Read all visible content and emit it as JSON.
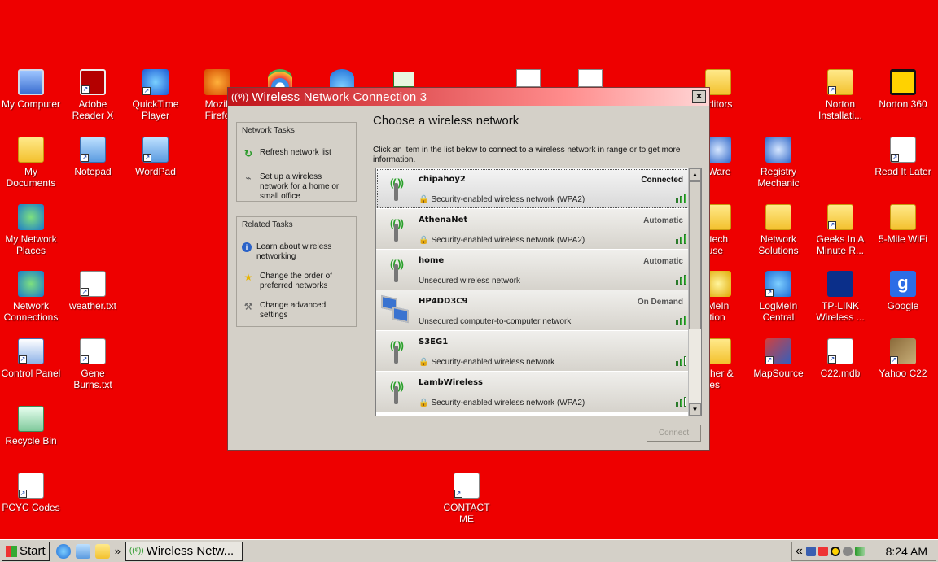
{
  "desktop": {
    "icons": [
      {
        "label": "My Computer"
      },
      {
        "label": "Adobe\nReader X"
      },
      {
        "label": "QuickTime\nPlayer"
      },
      {
        "label": "Mozill\nFirefo"
      },
      {
        "label": "My\nDocuments"
      },
      {
        "label": "Notepad"
      },
      {
        "label": "WordPad"
      },
      {
        "label": "My Network\nPlaces"
      },
      {
        "label": "Network\nConnections"
      },
      {
        "label": "weather.txt"
      },
      {
        "label": "Control Panel"
      },
      {
        "label": "Gene\nBurns.txt"
      },
      {
        "label": "Recycle Bin"
      },
      {
        "label": "PCYC Codes"
      },
      {
        "label": "CONTACT\nME"
      },
      {
        "label": "Editors"
      },
      {
        "label": "rtWare"
      },
      {
        "label": "gitech\nouse"
      },
      {
        "label": "gMeIn\nnition"
      },
      {
        "label": "ather &\nides"
      },
      {
        "label": "Registry\nMechanic"
      },
      {
        "label": "Network\nSolutions"
      },
      {
        "label": "LogMeIn\nCentral"
      },
      {
        "label": "MapSource"
      },
      {
        "label": "Norton\nInstallati..."
      },
      {
        "label": "Geeks In A\nMinute R..."
      },
      {
        "label": "TP-LINK\nWireless ..."
      },
      {
        "label": "C22.mdb"
      },
      {
        "label": "Norton 360"
      },
      {
        "label": "Read It Later"
      },
      {
        "label": "5-Mile WiFi"
      },
      {
        "label": "Google"
      },
      {
        "label": "Yahoo C22"
      }
    ]
  },
  "dialog": {
    "title": "Wireless Network Connection 3",
    "close": "×",
    "network_tasks": {
      "header": "Network Tasks",
      "items": [
        {
          "label": "Refresh network list"
        },
        {
          "label": "Set up a wireless network for a home or small office"
        }
      ]
    },
    "related_tasks": {
      "header": "Related Tasks",
      "items": [
        {
          "label": "Learn about wireless networking"
        },
        {
          "label": "Change the order of preferred networks"
        },
        {
          "label": "Change advanced settings"
        }
      ]
    },
    "heading": "Choose a wireless network",
    "intro": "Click an item in the list below to connect to a wireless network in range or to get more information.",
    "networks": [
      {
        "name": "chipahoy2",
        "status": "Connected",
        "desc": "Security-enabled wireless network (WPA2)",
        "secured": true,
        "signal": 5
      },
      {
        "name": "AthenaNet",
        "status": "Automatic",
        "desc": "Security-enabled wireless network (WPA2)",
        "secured": true,
        "signal": 4
      },
      {
        "name": "home",
        "status": "Automatic",
        "desc": "Unsecured wireless network",
        "secured": false,
        "signal": 4
      },
      {
        "name": "HP4DD3C9",
        "status": "On Demand",
        "desc": "Unsecured computer-to-computer network",
        "secured": false,
        "signal": 4
      },
      {
        "name": "S3EG1",
        "status": "",
        "desc": "Security-enabled wireless network",
        "secured": true,
        "signal": 2
      },
      {
        "name": "LambWireless",
        "status": "",
        "desc": "Security-enabled wireless network (WPA2)",
        "secured": true,
        "signal": 2
      }
    ],
    "connect_label": "Connect"
  },
  "taskbar": {
    "start_label": "Start",
    "chevron": "»",
    "task_button_label": "Wireless Netw...",
    "tray_chevron": "«",
    "clock": "8:24 AM"
  }
}
